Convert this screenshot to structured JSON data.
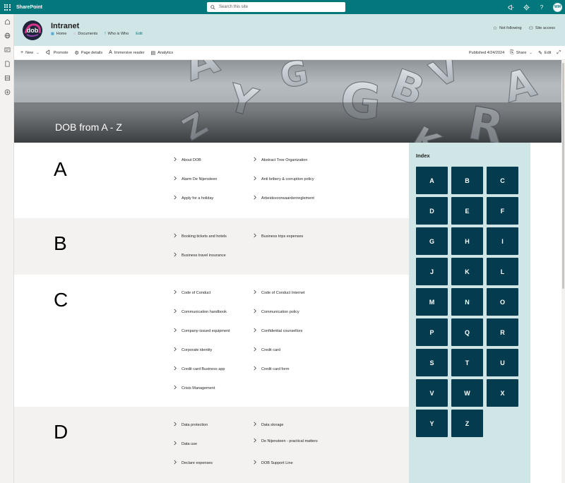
{
  "suite": {
    "app_name": "SharePoint",
    "search_placeholder": "Search this site",
    "user_initials": "WM"
  },
  "site": {
    "title": "Intranet",
    "nav": [
      {
        "label": "Home"
      },
      {
        "label": "Documents"
      },
      {
        "label": "Who is Who"
      },
      {
        "label": "Edit"
      }
    ],
    "not_following_label": "Not following",
    "site_access_label": "Site access"
  },
  "commandbar": {
    "new_label": "New",
    "promote_label": "Promote",
    "page_details_label": "Page details",
    "immersive_reader_label": "Immersive reader",
    "analytics_label": "Analytics",
    "published_label": "Published 4/24/2024",
    "share_label": "Share",
    "edit_label": "Edit"
  },
  "hero": {
    "title": "DOB from A - Z"
  },
  "sections": [
    {
      "letter": "A",
      "links": [
        "About DOB",
        "Abstract Tree Organization",
        "Alarm De Nijensteen",
        "Anti bribery & corruption policy",
        "Apply for a holiday",
        "Arbeidsvoorwaardenreglement"
      ]
    },
    {
      "letter": "B",
      "links": [
        "Booking tickets and hotels",
        "Business trips expenses",
        "Business travel insurance"
      ]
    },
    {
      "letter": "C",
      "links": [
        "Code of Conduct",
        "Code of Conduct Internet",
        "Communication handbook",
        "Communication policy",
        "Company-issued equipment",
        "Confidential counsellors",
        "Corporate identity",
        "Credit card",
        "Credit card Business app",
        "Credit card form",
        "Crisis Management"
      ]
    },
    {
      "letter": "D",
      "links": [
        "Data protection",
        "Data storage",
        "Data use",
        "De Nijensteen - practical matters",
        "Declare expenses",
        "DOB Support Line"
      ]
    }
  ],
  "index": {
    "title": "Index",
    "letters": [
      "A",
      "B",
      "C",
      "D",
      "E",
      "F",
      "G",
      "H",
      "I",
      "J",
      "K",
      "L",
      "M",
      "N",
      "O",
      "P",
      "Q",
      "R",
      "S",
      "T",
      "U",
      "V",
      "W",
      "X",
      "Y",
      "Z"
    ]
  },
  "colors": {
    "suite_bar": "#03787c",
    "header_bg": "#d0e5e6",
    "tile_bg": "#043b4e"
  }
}
